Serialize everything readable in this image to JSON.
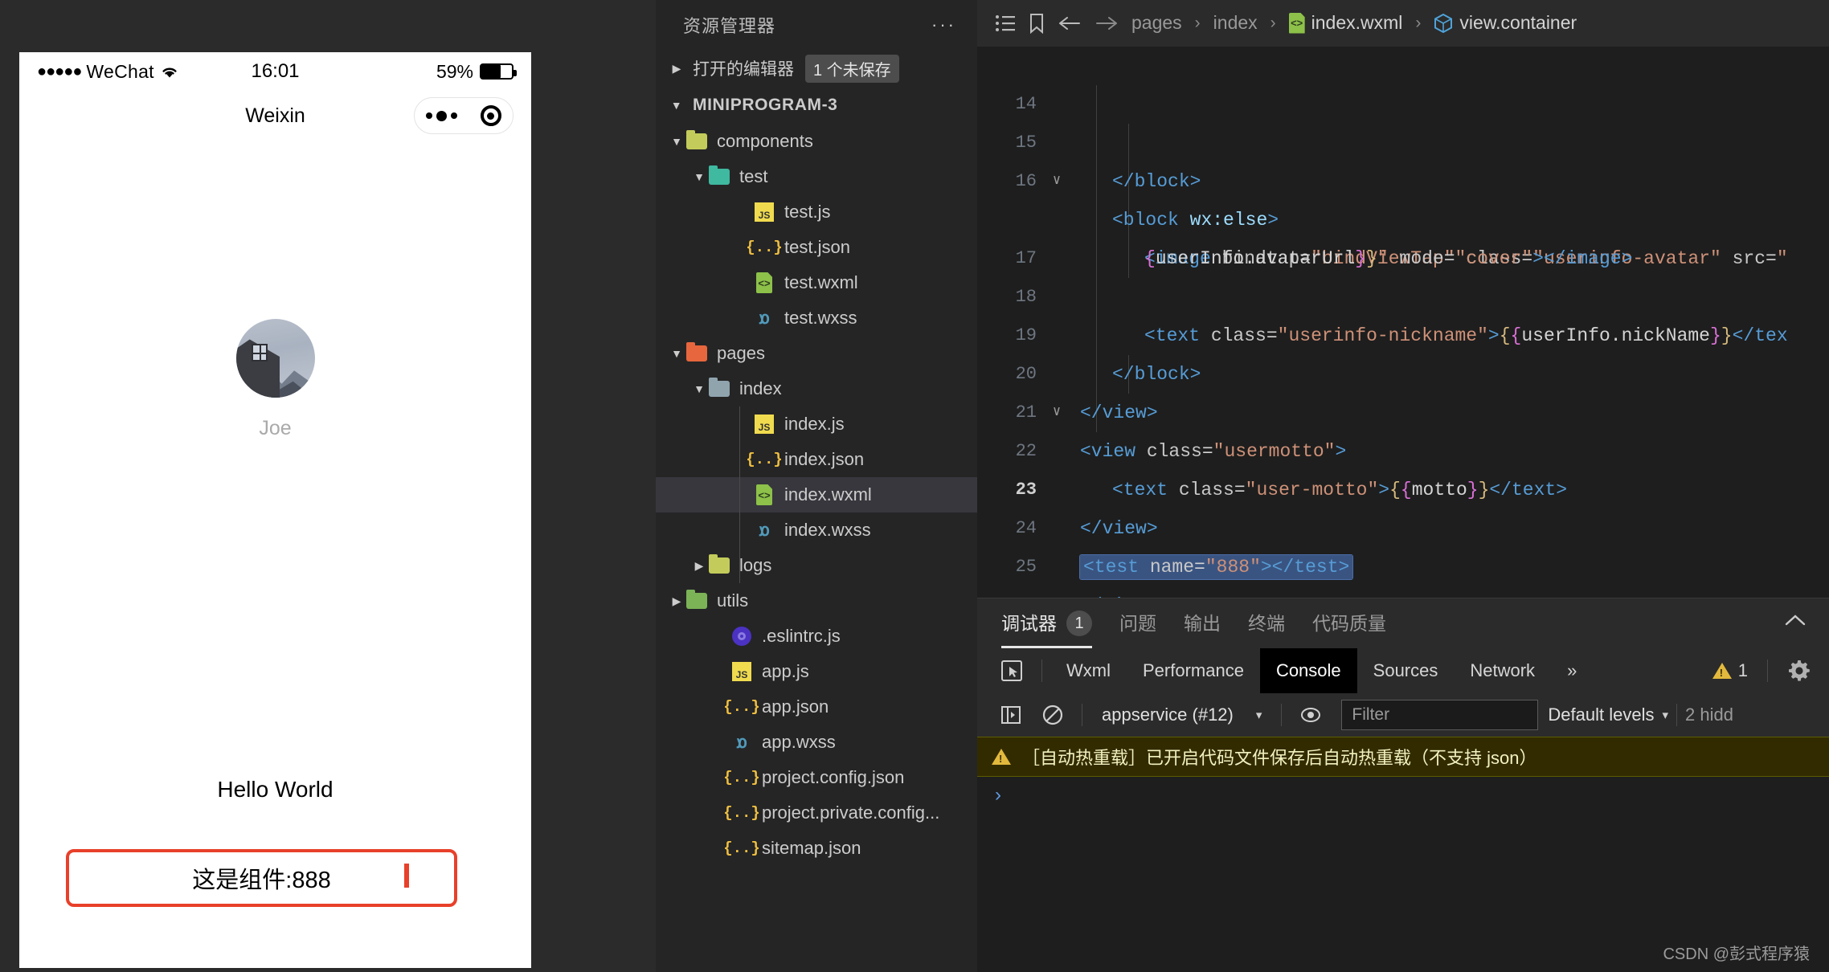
{
  "simulator": {
    "status_bar": {
      "carrier_dots": "●●●●●",
      "carrier": "WeChat",
      "wifi_icon": "wifi-icon",
      "time": "16:01",
      "battery_percent": "59%",
      "battery_level": 62
    },
    "nav": {
      "title": "Weixin",
      "capsule_more_icon": "more-dots-icon",
      "capsule_target_icon": "target-icon"
    },
    "user": {
      "avatar_alt": "user-avatar",
      "nickname": "Joe"
    },
    "motto": "Hello World",
    "component": {
      "text": "这是组件:888",
      "border_color": "#e8402a"
    }
  },
  "explorer": {
    "title": "资源管理器",
    "more_icon": "ellipsis-icon",
    "open_editors": {
      "label": "打开的编辑器",
      "badge": "1 个未保存"
    },
    "project_root": "MINIPROGRAM-3",
    "tree": [
      {
        "label": "components",
        "type": "folder",
        "icon": "folder-components-icon",
        "depth": 1,
        "expanded": true,
        "color": "#c3cc5a"
      },
      {
        "label": "test",
        "type": "folder",
        "icon": "folder-test-icon",
        "depth": 2,
        "expanded": true,
        "color": "#3fb9a0"
      },
      {
        "label": "test.js",
        "type": "js",
        "icon": "js-file-icon",
        "depth": 3
      },
      {
        "label": "test.json",
        "type": "json",
        "icon": "json-file-icon",
        "depth": 3
      },
      {
        "label": "test.wxml",
        "type": "wxml",
        "icon": "wxml-file-icon",
        "depth": 3
      },
      {
        "label": "test.wxss",
        "type": "wxss",
        "icon": "wxss-file-icon",
        "depth": 3
      },
      {
        "label": "pages",
        "type": "folder",
        "icon": "folder-pages-icon",
        "depth": 1,
        "expanded": true,
        "color": "#e8663d"
      },
      {
        "label": "index",
        "type": "folder",
        "icon": "folder-icon",
        "depth": 2,
        "expanded": true,
        "color": "#90a4ae"
      },
      {
        "label": "index.js",
        "type": "js",
        "icon": "js-file-icon",
        "depth": 3
      },
      {
        "label": "index.json",
        "type": "json",
        "icon": "json-file-icon",
        "depth": 3
      },
      {
        "label": "index.wxml",
        "type": "wxml",
        "icon": "wxml-file-icon",
        "depth": 3,
        "selected": true
      },
      {
        "label": "index.wxss",
        "type": "wxss",
        "icon": "wxss-file-icon",
        "depth": 3
      },
      {
        "label": "logs",
        "type": "folder",
        "icon": "folder-logs-icon",
        "depth": 2,
        "expanded": false,
        "color": "#c3cc5a"
      },
      {
        "label": "utils",
        "type": "folder",
        "icon": "folder-utils-icon",
        "depth": 1,
        "expanded": false,
        "color": "#7bb356"
      },
      {
        "label": ".eslintrc.js",
        "type": "eslint",
        "icon": "eslint-file-icon",
        "depth": 2
      },
      {
        "label": "app.js",
        "type": "js",
        "icon": "js-file-icon",
        "depth": 2
      },
      {
        "label": "app.json",
        "type": "json",
        "icon": "json-file-icon",
        "depth": 2
      },
      {
        "label": "app.wxss",
        "type": "wxss",
        "icon": "wxss-file-icon",
        "depth": 2
      },
      {
        "label": "project.config.json",
        "type": "json",
        "icon": "json-file-icon",
        "depth": 2
      },
      {
        "label": "project.private.config...",
        "type": "json",
        "icon": "json-file-icon",
        "depth": 2
      },
      {
        "label": "sitemap.json",
        "type": "json",
        "icon": "json-file-icon",
        "depth": 2
      }
    ]
  },
  "breadcrumb": {
    "outline_icon": "outline-list-icon",
    "bookmark_icon": "bookmark-icon",
    "back_icon": "arrow-left-icon",
    "forward_icon": "arrow-right-icon",
    "items": [
      "pages",
      "index",
      "index.wxml",
      "view.container"
    ],
    "separator": "›",
    "file_icon": "wxml-file-icon",
    "symbol_icon": "symbol-cube-icon"
  },
  "code": {
    "lines": [
      {
        "no": "14",
        "fold": "",
        "indent": 1
      },
      {
        "no": "15",
        "fold": "∨",
        "indent": 1
      },
      {
        "no": "16",
        "fold": "",
        "indent": 2
      },
      {
        "no": "",
        "fold": "",
        "indent": 2
      },
      {
        "no": "17",
        "fold": "",
        "indent": 2
      },
      {
        "no": "18",
        "fold": "",
        "indent": 1
      },
      {
        "no": "19",
        "fold": "",
        "indent": 1
      },
      {
        "no": "20",
        "fold": "∨",
        "indent": 1
      },
      {
        "no": "21",
        "fold": "",
        "indent": 2
      },
      {
        "no": "22",
        "fold": "",
        "indent": 1
      },
      {
        "no": "23",
        "fold": "",
        "indent": 1,
        "current": true,
        "selected": true
      },
      {
        "no": "24",
        "fold": "",
        "indent": 0
      },
      {
        "no": "25",
        "fold": "",
        "indent": 0
      }
    ],
    "text": {
      "l14": "</block>",
      "l15": "<block wx:else>",
      "l16": "<image bindtap=\"bindViewTap\" class=\"userinfo-avatar\" src=\"",
      "l16b": "{userInfo.avatarUrl}}\" mode=\"cover\"></image>",
      "l17": "<text class=\"userinfo-nickname\">{{userInfo.nickName}}</tex",
      "l18": "</block>",
      "l19": "</view>",
      "l20": "<view class=\"usermotto\">",
      "l21": "<text class=\"user-motto\">{{motto}}</text>",
      "l22": "</view>",
      "l23": "<test name=\"888\"></test>",
      "l24": "</view>",
      "l25": ""
    }
  },
  "panel": {
    "tabs": [
      {
        "label": "调试器",
        "badge": "1",
        "active": true
      },
      {
        "label": "问题",
        "active": false
      },
      {
        "label": "输出",
        "active": false
      },
      {
        "label": "终端",
        "active": false
      },
      {
        "label": "代码质量",
        "active": false
      }
    ],
    "collapse_icon": "chevron-up-icon",
    "devtools_tabs": [
      {
        "label": "Wxml",
        "active": false
      },
      {
        "label": "Performance",
        "active": false
      },
      {
        "label": "Console",
        "active": true
      },
      {
        "label": "Sources",
        "active": false
      },
      {
        "label": "Network",
        "active": false
      }
    ],
    "more_tabs_icon": "chevron-double-right-icon",
    "inspect_icon": "inspect-cursor-icon",
    "warning_count": "1",
    "settings_icon": "gear-icon",
    "console": {
      "sidebar_icon": "show-console-sidebar-icon",
      "clear_icon": "clear-console-icon",
      "context": "appservice (#12)",
      "context_caret": "▾",
      "eye_icon": "live-expression-icon",
      "filter_placeholder": "Filter",
      "filter_value": "",
      "levels": "Default levels",
      "levels_caret": "▾",
      "hidden": "2 hidd",
      "warning_icon": "warning-triangle-icon",
      "warning_message": "［自动热重载］已开启代码文件保存后自动热重载（不支持 json）",
      "prompt": "›"
    }
  },
  "watermark": "CSDN @彭式程序猿"
}
